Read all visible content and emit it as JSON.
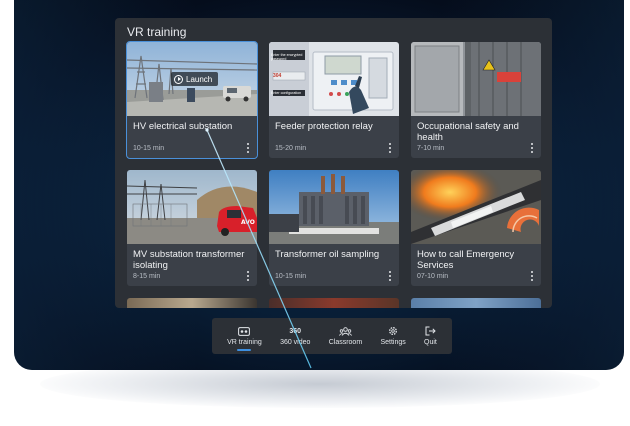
{
  "panel": {
    "title": "VR training"
  },
  "cards": [
    {
      "title": "HV electrical substation",
      "duration": "10-15 min",
      "launch_label": "Launch",
      "thumb_icon": "hv-substation-thumbnail"
    },
    {
      "title": "Feeder protection relay",
      "duration": "15-20 min",
      "thumb_icon": "protection-relay-thumbnail"
    },
    {
      "title": "Occupational safety and health",
      "duration": "7-10 min",
      "thumb_icon": "electrical-cabinet-thumbnail"
    },
    {
      "title": "MV substation transformer isolating",
      "duration": "8-15 min",
      "thumb_icon": "mv-substation-thumbnail"
    },
    {
      "title": "Transformer oil sampling",
      "duration": "10-15 min",
      "thumb_icon": "transformer-thumbnail"
    },
    {
      "title": "How to call Emergency Services",
      "duration": "07-10 min",
      "thumb_icon": "burning-cable-thumbnail"
    }
  ],
  "relay_screen": {
    "prompt": "Enter the encrypted password",
    "code": "304",
    "note": "Enter configuration"
  },
  "nav": [
    {
      "label": "VR training",
      "icon": "vr-headset-icon",
      "active": true
    },
    {
      "label": "360 video",
      "icon": "360-icon",
      "icon_text": "360",
      "active": false
    },
    {
      "label": "Classroom",
      "icon": "classroom-icon",
      "active": false
    },
    {
      "label": "Settings",
      "icon": "gear-icon",
      "active": false
    },
    {
      "label": "Quit",
      "icon": "exit-icon",
      "active": false
    }
  ],
  "colors": {
    "panel": "#2c3036",
    "card": "#3b4048",
    "accent": "#3d8fe0",
    "selection": "#4a90d9"
  }
}
